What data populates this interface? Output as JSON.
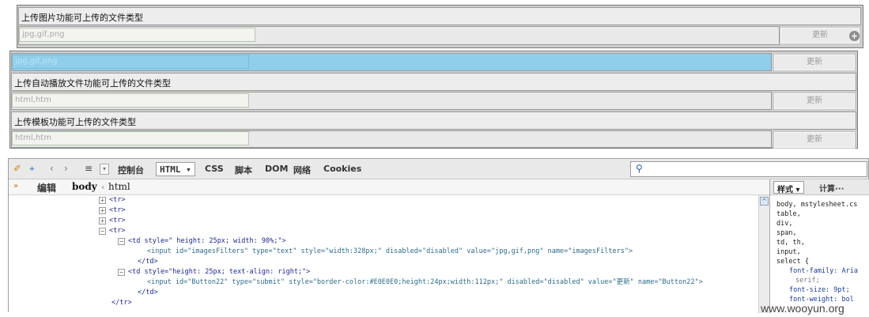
{
  "form": {
    "row1_label": "上传图片功能可上传的文件类型",
    "row1_value": "jpg,gif,png",
    "row1_button": "更新",
    "row2_value": "jpg,gif,png",
    "row2_button": "更新",
    "row3_label": "上传自动播放文件功能可上传的文件类型",
    "row3_value": "html,htm",
    "row3_button": "更新",
    "row4_label": "上传模板功能可上传的文件类型",
    "row4_value": "html,htm",
    "row4_button": "更新",
    "highlight_color": "#8fcfec"
  },
  "devtools": {
    "tabs": [
      "控制台",
      "HTML ▾",
      "CSS",
      "脚本",
      "DOM",
      "网络",
      "Cookies"
    ],
    "selected_tab": "HTML ▾",
    "breadcrumb_edit": "编辑",
    "breadcrumb_body": "body",
    "breadcrumb_html": "html",
    "side_tab_style": "样式 ▾",
    "side_tab_computed": "计算···",
    "code_lines": [
      "<tr>",
      "<tr>",
      "<tr>",
      "<tr>",
      "<td style=\" height: 25px; width: 90%;\">",
      "<input id=\"imagesFilters\" type=\"text\" style=\"width:328px;\" disabled=\"disabled\" value=\"jpg,gif,png\" name=\"imagesFilters\">",
      "</td>",
      "<td style=\"height: 25px; text-align: right;\">",
      "<input id=\"Button22\" type=\"submit\" style=\"border-color:#E0E0E0;height:24px;width:112px;\" disabled=\"disabled\" value=\"更新\" name=\"Button22\">",
      "</td>",
      "</tr>"
    ],
    "css_lines": [
      "body, mstylesheet.cs",
      "table,",
      "div,",
      "span,",
      "td, th,",
      "input,",
      "select {",
      "font-family: Aria",
      "serif;",
      "font-size: 9pt;",
      "font-weight: bol"
    ]
  },
  "watermark": "www.wooyun.org"
}
